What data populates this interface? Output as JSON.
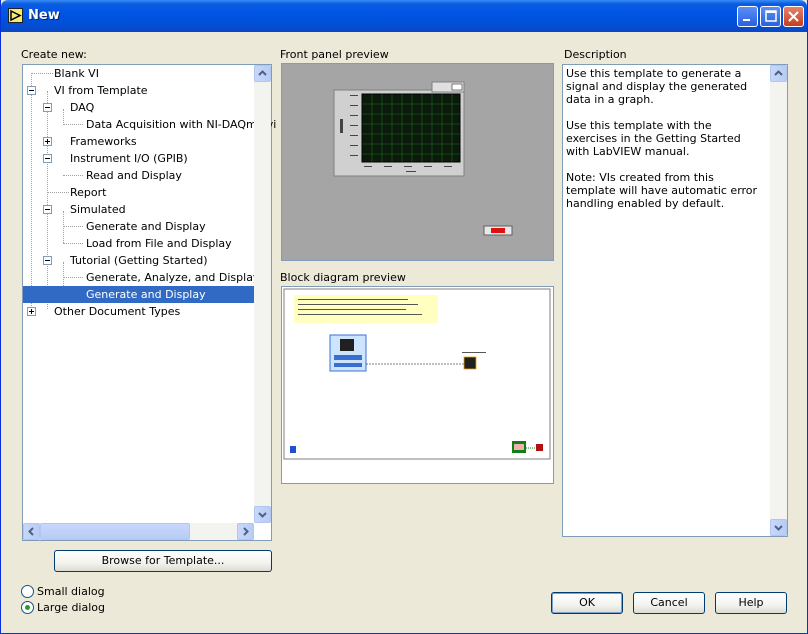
{
  "window": {
    "title": "New"
  },
  "labels": {
    "create_new": "Create new:",
    "front_panel_preview": "Front panel preview",
    "block_diagram_preview": "Block diagram preview",
    "description": "Description"
  },
  "tree": {
    "items": [
      {
        "label": "Blank VI"
      },
      {
        "label": "VI from Template"
      },
      {
        "label": "DAQ"
      },
      {
        "label": "Data Acquisition with NI-DAQmx.vi"
      },
      {
        "label": "Frameworks"
      },
      {
        "label": "Instrument I/O (GPIB)"
      },
      {
        "label": "Read and Display"
      },
      {
        "label": "Report"
      },
      {
        "label": "Simulated"
      },
      {
        "label": "Generate and Display"
      },
      {
        "label": "Load from File and Display"
      },
      {
        "label": "Tutorial (Getting Started)"
      },
      {
        "label": "Generate, Analyze, and Display"
      },
      {
        "label": "Generate and Display"
      },
      {
        "label": "Other Document Types"
      }
    ],
    "selected_index": 13
  },
  "description": {
    "text": "Use this template to generate a signal and display the generated data in a graph.\n\nUse this template with the exercises in the Getting Started with LabVIEW manual.\n\nNote: VIs created from this template will have automatic error handling enabled by default."
  },
  "buttons": {
    "browse": "Browse for Template...",
    "ok": "OK",
    "cancel": "Cancel",
    "help": "Help"
  },
  "dialog_size": {
    "options": [
      "Small dialog",
      "Large dialog"
    ],
    "selected": "Large dialog"
  }
}
